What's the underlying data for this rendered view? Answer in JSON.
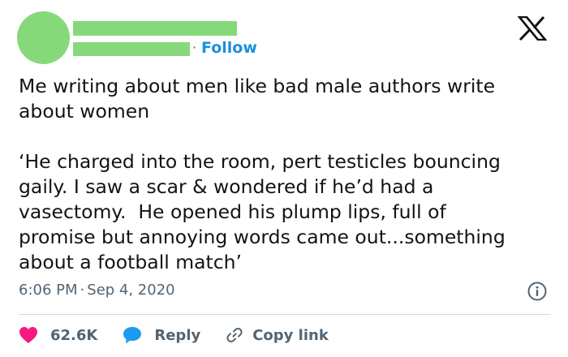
{
  "header": {
    "separator": "·",
    "follow_label": "Follow"
  },
  "tweet": {
    "text": "Me writing about men like bad male authors write\nabout women\n\n‘He charged into the room, pert testicles bouncing\ngaily. I saw a scar & wondered if he’d had a\nvasectomy.  He opened his plump lips, full of\npromise but annoying words came out...something\nabout a football match’",
    "time": "6:06 PM",
    "separator": "·",
    "date": "Sep 4, 2020"
  },
  "actions": {
    "likes": "62.6K",
    "reply_label": "Reply",
    "copy_label": "Copy link"
  },
  "icons": [
    "x-logo-icon",
    "info-icon",
    "heart-icon",
    "reply-bubble-icon",
    "link-icon"
  ],
  "colors": {
    "redaction": "#86d97a",
    "follow": "#1d8fe0",
    "heart": "#f91880",
    "reply": "#1d9bf0",
    "muted": "#536471"
  }
}
